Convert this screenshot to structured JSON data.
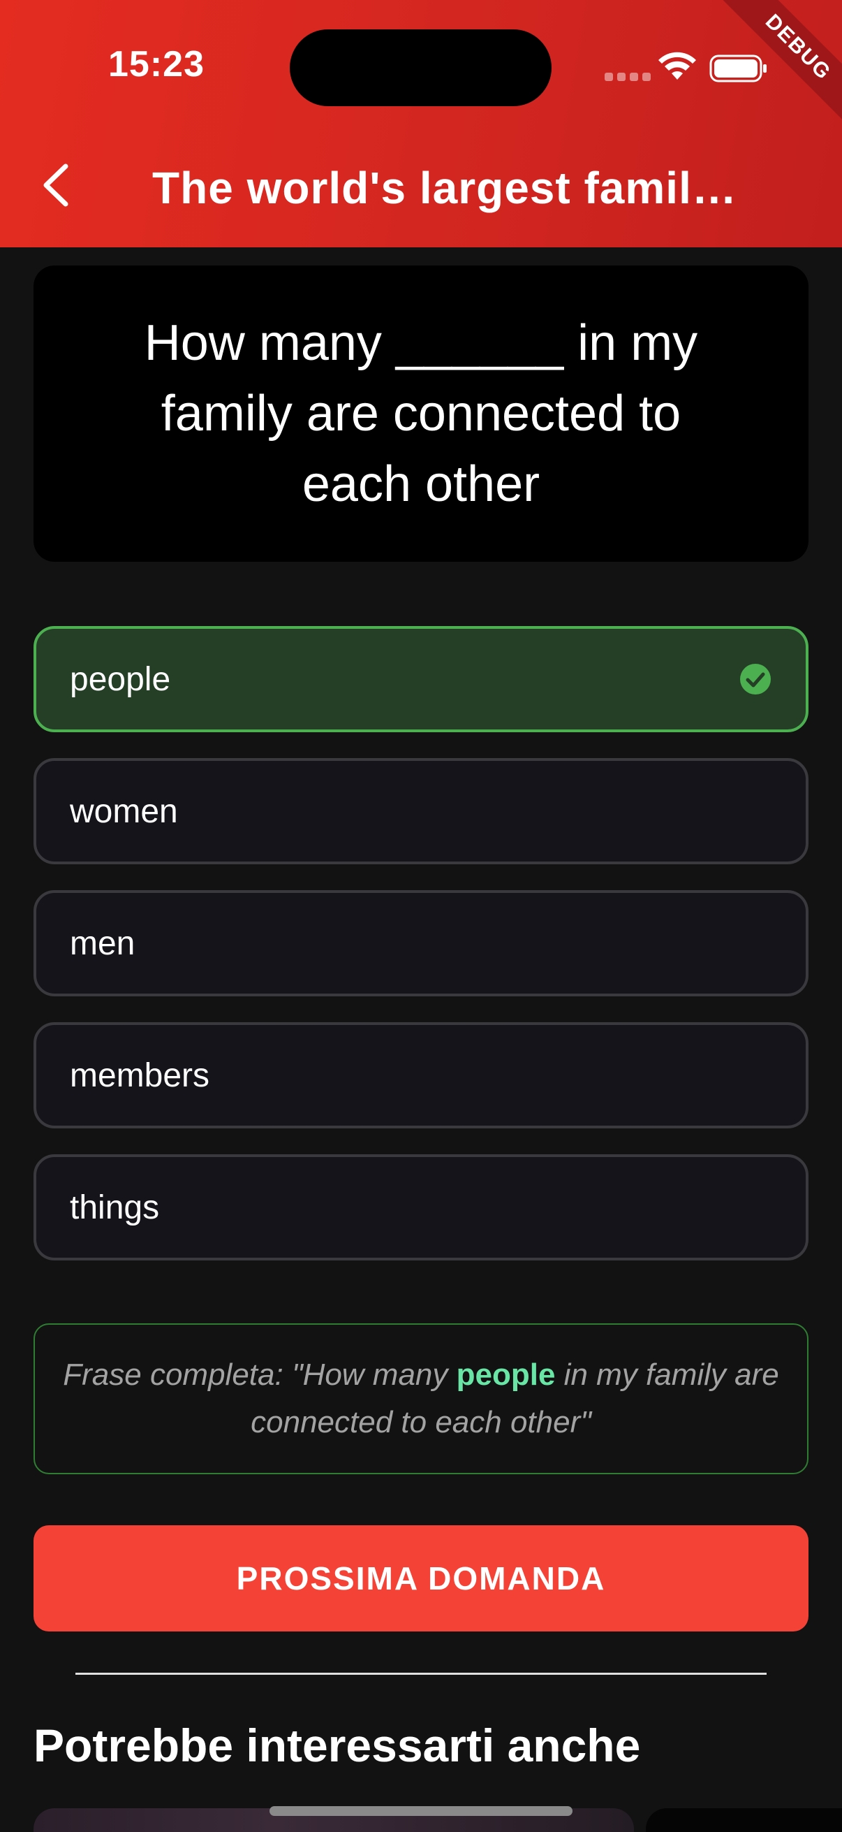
{
  "status_bar": {
    "time": "15:23",
    "debug_label": "DEBUG"
  },
  "app_bar": {
    "title": "The world's largest famil…",
    "back_icon": "chevron-left-icon"
  },
  "question": {
    "text": "How many ______ in my family are connected to each other"
  },
  "options": [
    {
      "label": "people",
      "state": "correct"
    },
    {
      "label": "women",
      "state": "default"
    },
    {
      "label": "men",
      "state": "default"
    },
    {
      "label": "members",
      "state": "default"
    },
    {
      "label": "things",
      "state": "default"
    }
  ],
  "answer": {
    "prefix": "Frase completa: \"How many ",
    "highlight": "people",
    "suffix": " in my family are connected to each other\""
  },
  "next_button": {
    "label": "PROSSIMA DOMANDA"
  },
  "related": {
    "title": "Potrebbe interessarti anche"
  },
  "colors": {
    "header": "#d12520",
    "correct_border": "#4caf50",
    "correct_bg": "#243f26",
    "highlight": "#69e6a6",
    "button": "#f44336",
    "background": "#121212"
  }
}
